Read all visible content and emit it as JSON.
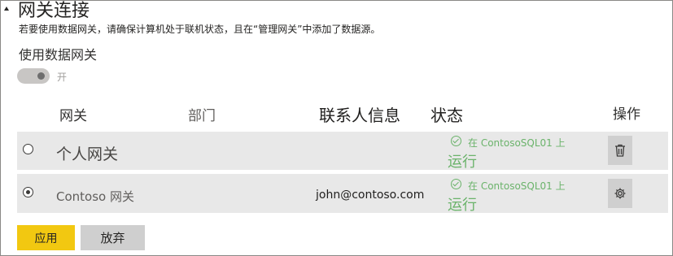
{
  "section": {
    "title": "网关连接",
    "description": "若要使用数据网关，请确保计算机处于联机状态，且在“管理网关”中添加了数据源。"
  },
  "toggle": {
    "label": "使用数据网关",
    "state_text": "开",
    "on": true
  },
  "table": {
    "headers": {
      "gateway": "网关",
      "department": "部门",
      "contact": "联系人信息",
      "status": "状态",
      "actions": "操作"
    },
    "rows": [
      {
        "gateway": "个人网关",
        "contact": "",
        "status_detail": "在 ContosoSQL01 上",
        "status": "运行",
        "selected": false,
        "action_icon": "trash-icon"
      },
      {
        "gateway": "Contoso 网关",
        "contact": "john@contoso.com",
        "status_detail": "在 ContosoSQL01 上",
        "status": "运行",
        "selected": true,
        "action_icon": "gear-icon"
      }
    ]
  },
  "buttons": {
    "apply": "应用",
    "discard": "放弃"
  },
  "colors": {
    "accent": "#f2c811",
    "status_ok": "#6bb36b",
    "row_background": "#e8e8e8"
  }
}
